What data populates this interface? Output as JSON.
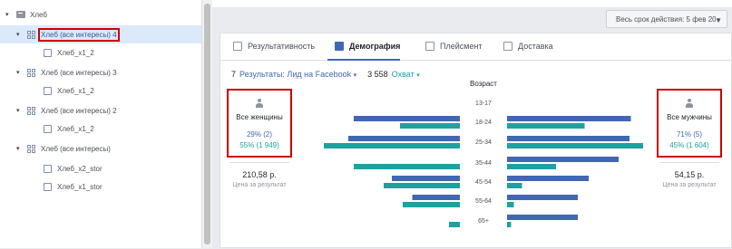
{
  "tree": {
    "items": [
      {
        "label": "Хлеб",
        "kind": "campaign",
        "expanded": true
      },
      {
        "label": "Хлеб (все интересы) 4",
        "kind": "adset",
        "expanded": true,
        "selected": true
      },
      {
        "label": "Хлеб_х1_2",
        "kind": "ad"
      },
      {
        "label": "Хлеб (все интересы) 3",
        "kind": "adset",
        "expanded": true
      },
      {
        "label": "Хлеб_х1_2",
        "kind": "ad"
      },
      {
        "label": "Хлеб (все интересы) 2",
        "kind": "adset",
        "expanded": true
      },
      {
        "label": "Хлеб_х1_2",
        "kind": "ad"
      },
      {
        "label": "Хлеб (все интересы)",
        "kind": "adset",
        "expanded": true
      },
      {
        "label": "Хлеб_х2_stor",
        "kind": "ad"
      },
      {
        "label": "Хлеб_х1_stor",
        "kind": "ad"
      }
    ]
  },
  "date_range": {
    "label": "Весь срок действия: 5 фев 20"
  },
  "tabs": [
    {
      "label": "Результативность",
      "icon": "bar-chart-icon",
      "active": false
    },
    {
      "label": "Демография",
      "icon": "people-icon",
      "active": true
    },
    {
      "label": "Плейсмент",
      "icon": "placement-icon",
      "active": false
    },
    {
      "label": "Доставка",
      "icon": "delivery-icon",
      "active": false
    }
  ],
  "metrics": {
    "results_count": "7",
    "results_label": "Результаты: Лид на Facebook",
    "reach_count": "3 558",
    "reach_label": "Охват"
  },
  "women": {
    "title": "Все женщины",
    "results": "29% (2)",
    "reach": "55% (1 949)",
    "price": "210,58 р.",
    "price_label": "Цена за результат"
  },
  "men": {
    "title": "Все мужчины",
    "results": "71% (5)",
    "reach": "45% (1 604)",
    "price": "54,15 р.",
    "price_label": "Цена за результат"
  },
  "colors": {
    "results": "#4267b2",
    "reach": "#1ea1a0",
    "highlight": "#cc0000"
  },
  "chart_data": {
    "type": "bar",
    "title": "Возраст",
    "categories": [
      "13-17",
      "18-24",
      "25-34",
      "35-44",
      "45-54",
      "55-64",
      "65+"
    ],
    "series": [
      {
        "name": "Все женщины · Результаты",
        "side": "left",
        "values": [
          0,
          0.78,
          0.82,
          0,
          0.5,
          0.35,
          0
        ]
      },
      {
        "name": "Все женщины · Охват",
        "side": "left",
        "values": [
          0,
          0.44,
          1.0,
          0.78,
          0.56,
          0.42,
          0.08
        ]
      },
      {
        "name": "Все мужчины · Результаты",
        "side": "right",
        "values": [
          0,
          0.91,
          0.9,
          0.82,
          0.6,
          0.52,
          0.52
        ]
      },
      {
        "name": "Все мужчины · Охват",
        "side": "right",
        "values": [
          0,
          0.57,
          1.0,
          0.36,
          0.11,
          0.05,
          0.03
        ]
      }
    ]
  }
}
